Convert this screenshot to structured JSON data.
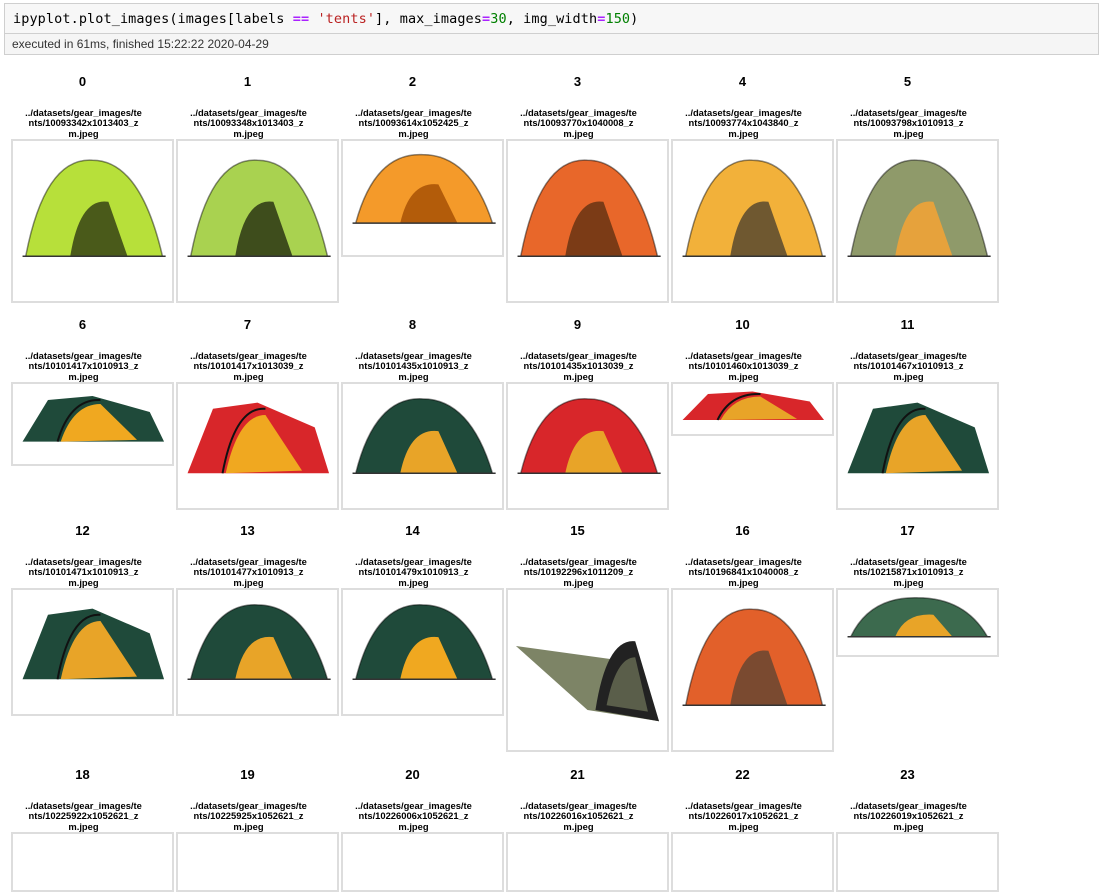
{
  "cell": {
    "code_prefix": "ipyplot.plot_images(images[labels ",
    "code_op": "==",
    "code_mid1": " ",
    "code_str": "'tents'",
    "code_mid2": "], max_images",
    "code_eq1": "=",
    "code_num1": "30",
    "code_mid3": ", img_width",
    "code_eq2": "=",
    "code_num2": "150",
    "code_end": ")",
    "exec_status": "executed in 61ms, finished 15:22:22 2020-04-29"
  },
  "items": [
    {
      "index": "0",
      "caption": "../datasets/gear_images/tents/10093342x1013403_zm.jpeg",
      "icon": "tent-image-green-dome",
      "tent_color": "#b7e03a",
      "accent": "#4a5a1a"
    },
    {
      "index": "1",
      "caption": "../datasets/gear_images/tents/10093348x1013403_zm.jpeg",
      "icon": "tent-image-green-dome",
      "tent_color": "#a9d250",
      "accent": "#3e4d1c"
    },
    {
      "index": "2",
      "caption": "../datasets/gear_images/tents/10093614x1052425_zm.jpeg",
      "icon": "tent-image-orange-dome",
      "tent_color": "#f49a2a",
      "accent": "#b35c0a"
    },
    {
      "index": "3",
      "caption": "../datasets/gear_images/tents/10093770x1040008_zm.jpeg",
      "icon": "tent-image-orange-dome",
      "tent_color": "#e8672a",
      "accent": "#7b3b16"
    },
    {
      "index": "4",
      "caption": "../datasets/gear_images/tents/10093774x1043840_zm.jpeg",
      "icon": "tent-image-yellow-dome",
      "tent_color": "#f2b13a",
      "accent": "#6f5830"
    },
    {
      "index": "5",
      "caption": "../datasets/gear_images/tents/10093798x1010913_zm.jpeg",
      "icon": "tent-image-olive-dome",
      "tent_color": "#8f9a6a",
      "accent": "#e6a23c"
    },
    {
      "index": "6",
      "caption": "../datasets/gear_images/tents/10101417x1010913_zm.jpeg",
      "icon": "tent-image-green-tunnel",
      "tent_color": "#1f4a3a",
      "accent": "#f0a820"
    },
    {
      "index": "7",
      "caption": "../datasets/gear_images/tents/10101417x1013039_zm.jpeg",
      "icon": "tent-image-red-tunnel",
      "tent_color": "#d8262a",
      "accent": "#f0a820"
    },
    {
      "index": "8",
      "caption": "../datasets/gear_images/tents/10101435x1010913_zm.jpeg",
      "icon": "tent-image-green-dome",
      "tent_color": "#1f4a3a",
      "accent": "#e8a428"
    },
    {
      "index": "9",
      "caption": "../datasets/gear_images/tents/10101435x1013039_zm.jpeg",
      "icon": "tent-image-red-dome",
      "tent_color": "#d8262a",
      "accent": "#e8a428"
    },
    {
      "index": "10",
      "caption": "../datasets/gear_images/tents/10101460x1013039_zm.jpeg",
      "icon": "tent-image-red-tunnel",
      "tent_color": "#d8262a",
      "accent": "#e8a428"
    },
    {
      "index": "11",
      "caption": "../datasets/gear_images/tents/10101467x1010913_zm.jpeg",
      "icon": "tent-image-green-tunnel",
      "tent_color": "#1f4a3a",
      "accent": "#e8a428"
    },
    {
      "index": "12",
      "caption": "../datasets/gear_images/tents/10101471x1010913_zm.jpeg",
      "icon": "tent-image-green-tunnel",
      "tent_color": "#1f4a3a",
      "accent": "#e8a428"
    },
    {
      "index": "13",
      "caption": "../datasets/gear_images/tents/10101477x1010913_zm.jpeg",
      "icon": "tent-image-green-dome",
      "tent_color": "#1f4a3a",
      "accent": "#e8a428"
    },
    {
      "index": "14",
      "caption": "../datasets/gear_images/tents/10101479x1010913_zm.jpeg",
      "icon": "tent-image-green-dome",
      "tent_color": "#1f4a3a",
      "accent": "#f0a820"
    },
    {
      "index": "15",
      "caption": "../datasets/gear_images/tents/10192296x1011209_zm.jpeg",
      "icon": "tent-image-olive-bivy",
      "tent_color": "#7d8466",
      "accent": "#222222"
    },
    {
      "index": "16",
      "caption": "../datasets/gear_images/tents/10196841x1040008_zm.jpeg",
      "icon": "tent-image-orange-dome",
      "tent_color": "#e2602a",
      "accent": "#7a4a30"
    },
    {
      "index": "17",
      "caption": "../datasets/gear_images/tents/10215871x1010913_zm.jpeg",
      "icon": "tent-image-green-dome",
      "tent_color": "#3c6a4e",
      "accent": "#e8a428"
    },
    {
      "index": "18",
      "caption": "../datasets/gear_images/tents/10225922x1052621_zm.jpeg",
      "icon": "tent-image-hidden",
      "tent_color": "#cccccc",
      "accent": "#999999"
    },
    {
      "index": "19",
      "caption": "../datasets/gear_images/tents/10225925x1052621_zm.jpeg",
      "icon": "tent-image-hidden",
      "tent_color": "#cccccc",
      "accent": "#999999"
    },
    {
      "index": "20",
      "caption": "../datasets/gear_images/tents/10226006x1052621_zm.jpeg",
      "icon": "tent-image-hidden",
      "tent_color": "#cccccc",
      "accent": "#999999"
    },
    {
      "index": "21",
      "caption": "../datasets/gear_images/tents/10226016x1052621_zm.jpeg",
      "icon": "tent-image-hidden",
      "tent_color": "#cccccc",
      "accent": "#999999"
    },
    {
      "index": "22",
      "caption": "../datasets/gear_images/tents/10226017x1052621_zm.jpeg",
      "icon": "tent-image-hidden",
      "tent_color": "#cccccc",
      "accent": "#999999"
    },
    {
      "index": "23",
      "caption": "../datasets/gear_images/tents/10226019x1052621_zm.jpeg",
      "icon": "tent-image-hidden",
      "tent_color": "#cccccc",
      "accent": "#999999"
    }
  ]
}
